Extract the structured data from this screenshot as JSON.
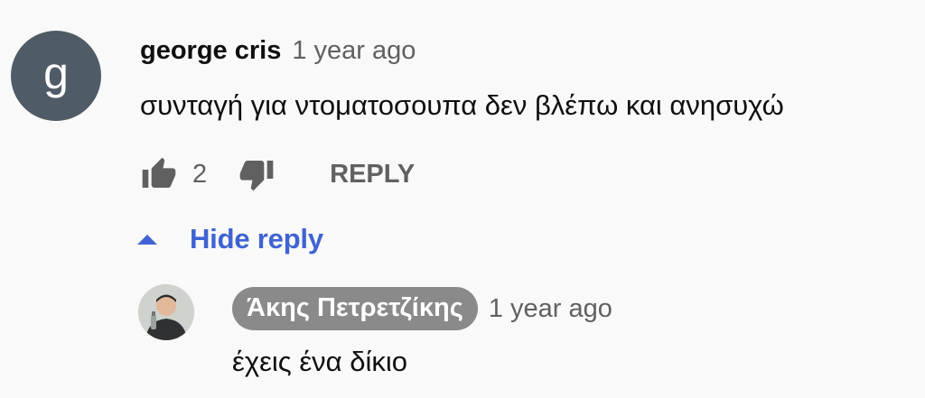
{
  "comment": {
    "avatar_letter": "g",
    "author": "george cris",
    "timestamp": "1 year ago",
    "text": "συνταγή για ντοματοσουπα δεν βλέπω και ανησυχώ",
    "like_count": "2",
    "reply_label": "REPLY",
    "icons": {
      "like": "thumbs-up-icon",
      "dislike": "thumbs-down-icon"
    }
  },
  "replies_toggle": {
    "label": "Hide reply",
    "icon": "caret-up-icon",
    "color": "#3f63d3"
  },
  "reply": {
    "author": "Άκης Πετρετζίκης",
    "timestamp": "1 year ago",
    "text": "έχεις ένα δίκιο",
    "badge_color": "#8a8a8a"
  },
  "colors": {
    "background": "#f9f9f9",
    "avatar_bg": "#4f5b66",
    "secondary_text": "#606060"
  }
}
